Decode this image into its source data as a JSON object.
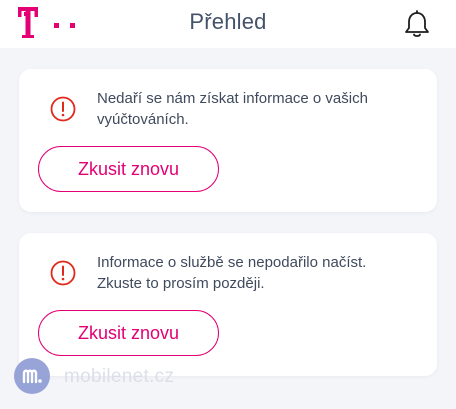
{
  "header": {
    "title": "Přehled",
    "logo_icon": "telekom-t-logo",
    "notification_icon": "bell-icon"
  },
  "colors": {
    "brand": "#e20074",
    "alert": "#e2281a",
    "title": "#44526a",
    "background": "#f3f5f9"
  },
  "cards": [
    {
      "icon": "alert-circle-icon",
      "message": "Nedaří se nám získat informace o vašich\nvyúčtováních.",
      "button_label": "Zkusit znovu"
    },
    {
      "icon": "alert-circle-icon",
      "message": "Informace o službě se nepodařilo načíst.\nZkuste to prosím později.",
      "button_label": "Zkusit znovu"
    }
  ],
  "watermark": {
    "text": "mobilenet.cz"
  }
}
